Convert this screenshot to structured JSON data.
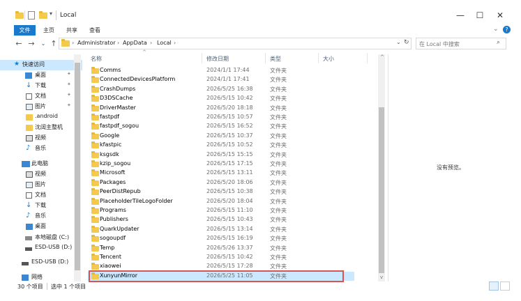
{
  "window": {
    "title": "Local",
    "minimize_icon": "minimize-icon",
    "maximize_icon": "maximize-icon",
    "close_icon": "close-icon"
  },
  "ribbon": {
    "tabs": [
      "文件",
      "主页",
      "共享",
      "查看"
    ]
  },
  "address": {
    "crumbs": [
      "Administrator",
      "AppData",
      "Local"
    ],
    "search_placeholder": "在 Local 中搜索"
  },
  "nav": {
    "items": [
      {
        "label": "快速访问",
        "icon": "star-icon"
      },
      {
        "label": "桌面",
        "icon": "desktop-icon",
        "pinned": true
      },
      {
        "label": "下载",
        "icon": "download-icon",
        "pinned": true
      },
      {
        "label": "文档",
        "icon": "document-icon",
        "pinned": true
      },
      {
        "label": "图片",
        "icon": "picture-icon",
        "pinned": true
      },
      {
        "label": ".android",
        "icon": "folder-icon"
      },
      {
        "label": "沈阔主整机",
        "icon": "folder-icon"
      },
      {
        "label": "视频",
        "icon": "video-icon"
      },
      {
        "label": "音乐",
        "icon": "music-icon"
      },
      {
        "label": "此电脑",
        "icon": "computer-icon"
      },
      {
        "label": "视频",
        "icon": "video-icon"
      },
      {
        "label": "图片",
        "icon": "picture-icon"
      },
      {
        "label": "文档",
        "icon": "document-icon"
      },
      {
        "label": "下载",
        "icon": "download-icon"
      },
      {
        "label": "音乐",
        "icon": "music-icon"
      },
      {
        "label": "桌面",
        "icon": "desktop-icon"
      },
      {
        "label": "本地磁盘 (C:)",
        "icon": "drive-icon"
      },
      {
        "label": "ESD-USB (D:)",
        "icon": "usb-drive-icon"
      },
      {
        "label": "ESD-USB (D:)",
        "icon": "usb-drive-icon"
      },
      {
        "label": "网络",
        "icon": "network-icon"
      }
    ]
  },
  "list": {
    "headers": {
      "name": "名称",
      "date": "修改日期",
      "type": "类型",
      "size": "大小"
    },
    "rows": [
      {
        "name": "Comms",
        "date": "2024/1/1 17:44",
        "type": "文件夹"
      },
      {
        "name": "ConnectedDevicesPlatform",
        "date": "2024/1/1 17:41",
        "type": "文件夹"
      },
      {
        "name": "CrashDumps",
        "date": "2026/5/25 16:38",
        "type": "文件夹"
      },
      {
        "name": "D3DSCache",
        "date": "2026/5/15 10:42",
        "type": "文件夹"
      },
      {
        "name": "DriverMaster",
        "date": "2026/5/20 18:18",
        "type": "文件夹"
      },
      {
        "name": "fastpdf",
        "date": "2026/5/15 10:57",
        "type": "文件夹"
      },
      {
        "name": "fastpdf_sogou",
        "date": "2026/5/15 16:52",
        "type": "文件夹"
      },
      {
        "name": "Google",
        "date": "2026/5/15 10:37",
        "type": "文件夹"
      },
      {
        "name": "kfastpic",
        "date": "2026/5/15 10:52",
        "type": "文件夹"
      },
      {
        "name": "ksgsdk",
        "date": "2026/5/15 15:15",
        "type": "文件夹"
      },
      {
        "name": "kzip_sogou",
        "date": "2026/5/15 17:15",
        "type": "文件夹"
      },
      {
        "name": "Microsoft",
        "date": "2026/5/15 13:11",
        "type": "文件夹"
      },
      {
        "name": "Packages",
        "date": "2026/5/20 18:06",
        "type": "文件夹"
      },
      {
        "name": "PeerDistRepub",
        "date": "2026/5/15 10:38",
        "type": "文件夹"
      },
      {
        "name": "PlaceholderTileLogoFolder",
        "date": "2026/5/20 18:04",
        "type": "文件夹"
      },
      {
        "name": "Programs",
        "date": "2026/5/15 11:10",
        "type": "文件夹"
      },
      {
        "name": "Publishers",
        "date": "2026/5/15 10:43",
        "type": "文件夹"
      },
      {
        "name": "QuarkUpdater",
        "date": "2026/5/15 13:14",
        "type": "文件夹"
      },
      {
        "name": "sogoupdf",
        "date": "2026/5/15 16:19",
        "type": "文件夹"
      },
      {
        "name": "Temp",
        "date": "2026/5/26 13:37",
        "type": "文件夹"
      },
      {
        "name": "Tencent",
        "date": "2026/5/15 10:42",
        "type": "文件夹"
      },
      {
        "name": "xiaowei",
        "date": "2026/5/15 17:28",
        "type": "文件夹"
      },
      {
        "name": "XunyunMirror",
        "date": "2026/5/25 11:05",
        "type": "文件夹",
        "selected": true
      }
    ]
  },
  "preview": {
    "text": "没有预览。"
  },
  "status": {
    "count": "30 个项目",
    "selected": "选中 1 个项目"
  },
  "colors": {
    "accent": "#1979ca",
    "selection": "#cce8ff",
    "highlight_border": "#d9534f",
    "folder": "#f3c94e"
  }
}
